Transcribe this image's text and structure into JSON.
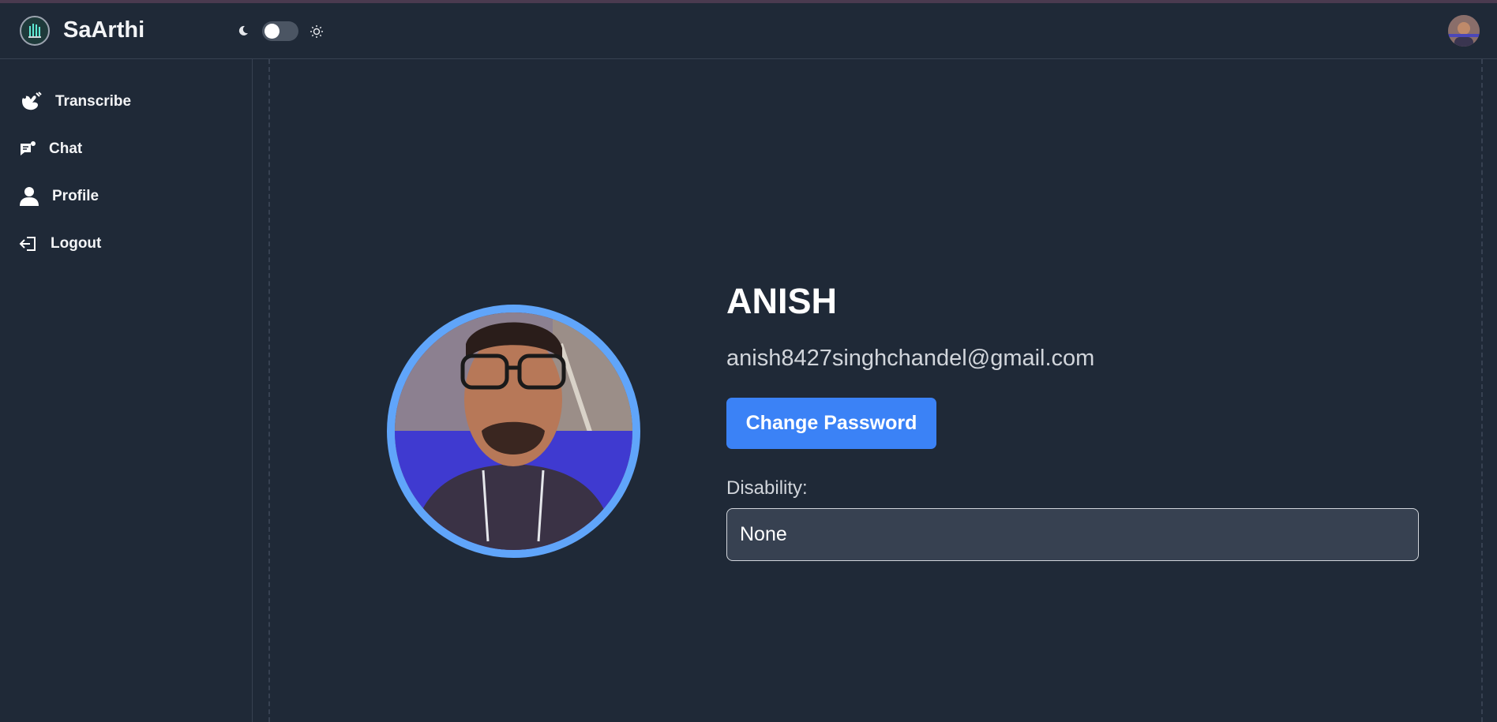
{
  "app": {
    "brand": "SaArthi"
  },
  "navbar": {
    "logo_icon": "hand-circuit-logo",
    "theme_toggle": {
      "moon_icon": "moon-icon",
      "sun_icon": "sun-icon",
      "state": "dark"
    },
    "avatar_icon": "user-avatar"
  },
  "sidebar": {
    "items": [
      {
        "label": "Transcribe",
        "icon": "sign-language-icon"
      },
      {
        "label": "Chat",
        "icon": "chat-icon"
      },
      {
        "label": "Profile",
        "icon": "user-icon"
      },
      {
        "label": "Logout",
        "icon": "logout-icon"
      }
    ]
  },
  "profile": {
    "name": "ANISH",
    "email": "anish8427singhchandel@gmail.com",
    "change_password_label": "Change Password",
    "disability_label": "Disability:",
    "disability_value": "None"
  },
  "colors": {
    "background": "#1f2937",
    "accent": "#3b82f6",
    "avatar_ring": "#60a5fa",
    "input_bg": "#374151"
  }
}
